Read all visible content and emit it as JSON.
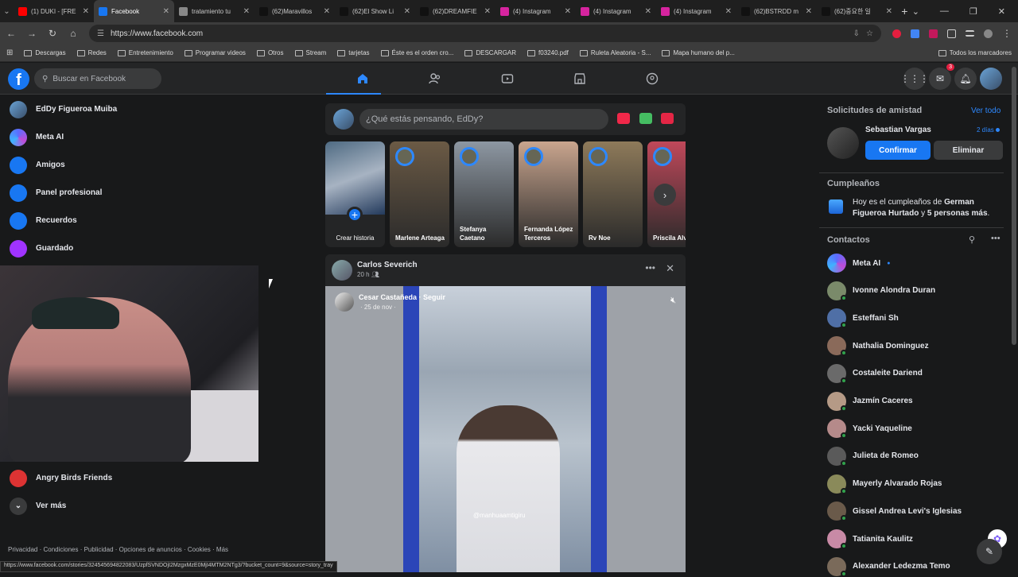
{
  "browser": {
    "tabs": [
      {
        "label": "(1) DUKI - [FRE",
        "color": "#ff0000"
      },
      {
        "label": "Facebook",
        "color": "#1877f2",
        "active": true
      },
      {
        "label": "tratamiento tu",
        "color": "#888888"
      },
      {
        "label": "(62)Maravillos",
        "color": "#111111"
      },
      {
        "label": "(62)El Show Li",
        "color": "#111111"
      },
      {
        "label": "(62)DREAMFIE",
        "color": "#111111"
      },
      {
        "label": "(4) Instagram",
        "color": "#d6249f"
      },
      {
        "label": "(4) Instagram",
        "color": "#d6249f"
      },
      {
        "label": "(4) Instagram",
        "color": "#d6249f"
      },
      {
        "label": "(62)BSTRDD m",
        "color": "#111111"
      },
      {
        "label": "(62)중요한 일",
        "color": "#111111"
      }
    ],
    "url": "https://www.facebook.com",
    "bookmarks": [
      "Descargas",
      "Redes",
      "Entretenimiento",
      "Programar videos",
      "Otros",
      "Stream",
      "tarjetas",
      "Éste es el orden cro...",
      "DESCARGAR",
      "f03240.pdf",
      "Ruleta Aleatoria - S...",
      "Mapa humano del p..."
    ],
    "bookmarks_right": "Todos los marcadores",
    "status_url": "https://www.facebook.com/stories/324545694822083/UzpfSVNDOjI2MzgxMzE0MjI4MTM2NTg3/?bucket_count=9&source=story_tray"
  },
  "fb": {
    "search_placeholder": "Buscar en Facebook",
    "messenger_badge": "3",
    "left_nav": [
      {
        "label": "EdDy Figueroa Muiba",
        "icon": "profile-avatar-icon"
      },
      {
        "label": "Meta AI",
        "icon": "meta-ai-icon"
      },
      {
        "label": "Amigos",
        "icon": "friends-icon"
      },
      {
        "label": "Panel profesional",
        "icon": "dashboard-icon"
      },
      {
        "label": "Recuerdos",
        "icon": "memories-icon"
      },
      {
        "label": "Guardado",
        "icon": "saved-icon"
      }
    ],
    "left_nav_lower": [
      {
        "label": "Angry Birds Friends",
        "icon": "angry-birds-icon"
      },
      {
        "label": "Ver más",
        "icon": "chevron-down-icon"
      }
    ],
    "footer": "Privacidad · Condiciones · Publicidad · Opciones de anuncios · Cookies · Más",
    "composer_placeholder": "¿Qué estás pensando, EdDy?",
    "stories": [
      {
        "name": "Crear historia",
        "create": true
      },
      {
        "name": "Marlene Arteaga",
        "color": "#6b5a45"
      },
      {
        "name": "Stefanya Caetano",
        "color": "#8d97a2"
      },
      {
        "name": "Fernanda López Terceros",
        "color": "#c9a58e"
      },
      {
        "name": "Rv Noe",
        "color": "#8e7a5a"
      },
      {
        "name": "Priscila Alve",
        "color": "#c0485a"
      }
    ],
    "post": {
      "author": "Carlos Severich",
      "time": "20 h",
      "reel_author": "Cesar Castañeda · Seguir",
      "reel_date": "· 25 de nov ·",
      "watermark": "@manhuaamtigiru"
    },
    "right": {
      "friend_requests_title": "Solicitudes de amistad",
      "see_all": "Ver todo",
      "request_name": "Sebastian Vargas",
      "request_age": "2 días",
      "confirm": "Confirmar",
      "delete": "Eliminar",
      "birthdays_title": "Cumpleaños",
      "birthday_text_pre": "Hoy es el cumpleaños de ",
      "birthday_text_bold1": "German Figueroa Hurtado",
      "birthday_text_mid": " y ",
      "birthday_text_bold2": "5 personas más",
      "birthday_text_end": ".",
      "contacts_title": "Contactos",
      "contacts": [
        {
          "name": "Meta AI",
          "color": "#5b6cff",
          "online": false
        },
        {
          "name": "Ivonne Alondra Duran",
          "color": "#7a8a6a",
          "online": true
        },
        {
          "name": "Esteffani Sh",
          "color": "#4f6fa6",
          "online": true
        },
        {
          "name": "Nathalia Dominguez",
          "color": "#8a6a5a",
          "online": true
        },
        {
          "name": "Costaleite Dariend",
          "color": "#6a6a6a",
          "online": true
        },
        {
          "name": "Jazmín Caceres",
          "color": "#b59a86",
          "online": true
        },
        {
          "name": "Yacki Yaqueline",
          "color": "#b58a8a",
          "online": true
        },
        {
          "name": "Julieta de Romeo",
          "color": "#5a5a5a",
          "online": true
        },
        {
          "name": "Mayerly Alvarado Rojas",
          "color": "#8a8a5a",
          "online": true
        },
        {
          "name": "Gissel Andrea Levi's Iglesias",
          "color": "#6a5a4a",
          "online": true
        },
        {
          "name": "Tatianita Kaulitz",
          "color": "#c88aa6",
          "online": true
        },
        {
          "name": "Alexander Ledezma Temo",
          "color": "#7a6a5a",
          "online": true
        }
      ]
    }
  }
}
